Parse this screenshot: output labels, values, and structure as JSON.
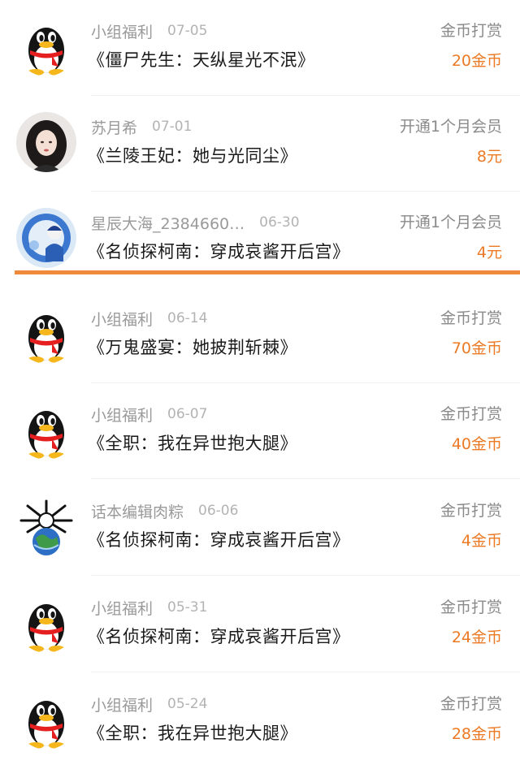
{
  "records": [
    {
      "name": "小组福利",
      "date": "07-05",
      "type": "金币打赏",
      "title": "《僵尸先生：天纵星光不泯》",
      "amount": "20金币",
      "avatar_icon": "qq-penguin-icon"
    },
    {
      "name": "苏月希",
      "date": "07-01",
      "type": "开通1个月会员",
      "title": "《兰陵王妃：她与光同尘》",
      "amount": "8元",
      "avatar_icon": "girl-portrait-avatar"
    },
    {
      "name": "星辰大海_2384660…",
      "date": "06-30",
      "type": "开通1个月会员",
      "title": "《名侦探柯南：穿成哀酱开后宫》",
      "amount": "4元",
      "avatar_icon": "anime-character-avatar"
    },
    {
      "name": "小组福利",
      "date": "06-14",
      "type": "金币打赏",
      "title": "《万鬼盛宴：她披荆斩棘》",
      "amount": "70金币",
      "avatar_icon": "qq-penguin-icon"
    },
    {
      "name": "小组福利",
      "date": "06-07",
      "type": "金币打赏",
      "title": "《全职：我在异世抱大腿》",
      "amount": "40金币",
      "avatar_icon": "qq-penguin-icon"
    },
    {
      "name": "话本编辑肉粽",
      "date": "06-06",
      "type": "金币打赏",
      "title": "《名侦探柯南：穿成哀酱开后宫》",
      "amount": "4金币",
      "avatar_icon": "earth-skulls-avatar"
    },
    {
      "name": "小组福利",
      "date": "05-31",
      "type": "金币打赏",
      "title": "《名侦探柯南：穿成哀酱开后宫》",
      "amount": "24金币",
      "avatar_icon": "qq-penguin-icon"
    },
    {
      "name": "小组福利",
      "date": "05-24",
      "type": "金币打赏",
      "title": "《全职：我在异世抱大腿》",
      "amount": "28金币",
      "avatar_icon": "qq-penguin-icon"
    }
  ],
  "colors": {
    "amount": "#ec7a25",
    "highlight_line": "#ef8a3c",
    "name": "#9a9a9a"
  }
}
